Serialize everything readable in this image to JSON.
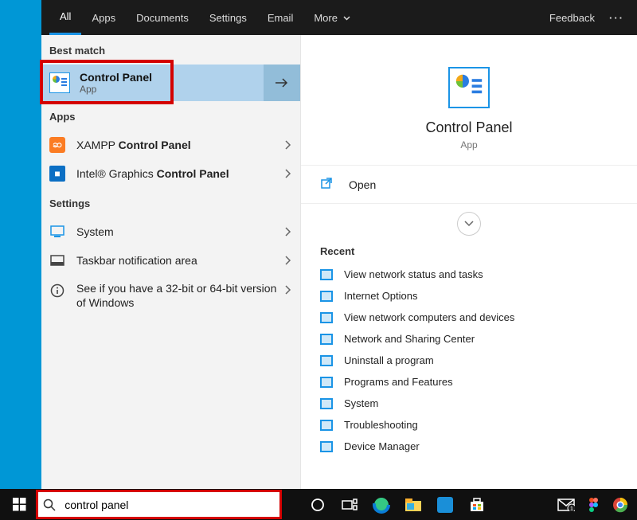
{
  "tabs": {
    "items": [
      "All",
      "Apps",
      "Documents",
      "Settings",
      "Email",
      "More"
    ],
    "active": 0,
    "feedback": "Feedback"
  },
  "left": {
    "best_match_label": "Best match",
    "best": {
      "title": "Control Panel",
      "sub": "App"
    },
    "apps_label": "Apps",
    "apps": [
      {
        "prefix": "XAMPP ",
        "bold": "Control Panel",
        "icon": "xampp"
      },
      {
        "prefix": "Intel® Graphics ",
        "bold": "Control Panel",
        "icon": "intel"
      }
    ],
    "settings_label": "Settings",
    "settings": [
      {
        "text": "System",
        "icon": "monitor"
      },
      {
        "text": "Taskbar notification area",
        "icon": "taskbar"
      },
      {
        "text": "See if you have a 32-bit or 64-bit version of Windows",
        "icon": "info"
      }
    ]
  },
  "right": {
    "title": "Control Panel",
    "sub": "App",
    "open": "Open",
    "recent_label": "Recent",
    "recent": [
      "View network status and tasks",
      "Internet Options",
      "View network computers and devices",
      "Network and Sharing Center",
      "Uninstall a program",
      "Programs and Features",
      "System",
      "Troubleshooting",
      "Device Manager"
    ]
  },
  "search": {
    "value": "control panel"
  }
}
